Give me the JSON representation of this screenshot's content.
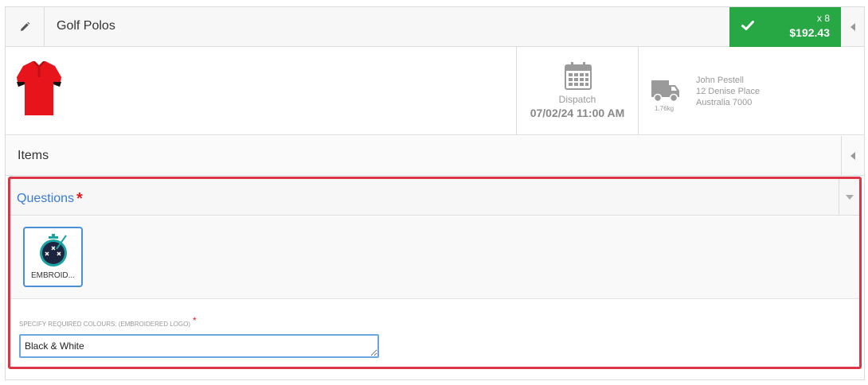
{
  "header": {
    "title": "Golf Polos",
    "quantity": "x 8",
    "total": "$192.43"
  },
  "details": {
    "dispatch_label": "Dispatch",
    "dispatch_date": "07/02/24 11:00 AM",
    "weight": "1.76kg",
    "address": {
      "name": "John Pestell",
      "street": "12 Denise Place",
      "region": "Australia 7000"
    }
  },
  "items": {
    "label": "Items"
  },
  "questions": {
    "label": "Questions",
    "required_marker": "*",
    "options": [
      {
        "label": "EMBROID..."
      }
    ],
    "field": {
      "label": "SPECIFY REQUIRED COLOURS: (EMBROIDERED LOGO)",
      "required_marker": "*",
      "value": "Black & White"
    }
  },
  "colors": {
    "success": "#28a745",
    "highlight_border": "#dc3545",
    "link_blue": "#3a7bd5",
    "product_red": "#e8141b"
  },
  "icons": [
    "pencil-icon",
    "check-icon",
    "caret-left-icon",
    "calendar-icon",
    "truck-icon",
    "caret-down-icon",
    "embroidery-icon"
  ]
}
